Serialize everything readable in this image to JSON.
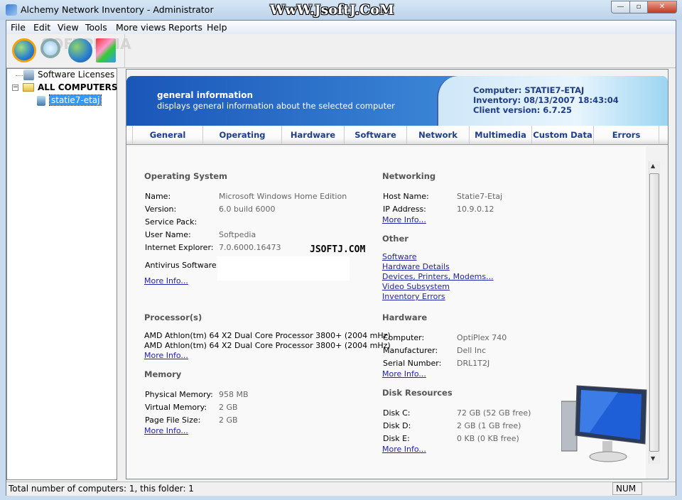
{
  "window": {
    "title": "Alchemy Network Inventory - Administrator",
    "watermark": "WwW.JsoftJ.CoM",
    "minimize": "—",
    "maximize": "▫",
    "close": "✕"
  },
  "menu": [
    "File",
    "Edit",
    "View",
    "Tools",
    "More views",
    "Reports",
    "Help"
  ],
  "toolbar": {
    "icons": [
      "refresh-globe-icon",
      "search-icon",
      "internet-explorer-icon",
      "reports-icon"
    ],
    "watermark": "SOFTPEDIA"
  },
  "tree": {
    "items": [
      {
        "label": "Software Licenses",
        "icon": "license-icon"
      },
      {
        "label": "ALL COMPUTERS",
        "icon": "folder-icon",
        "expander": "−"
      },
      {
        "label": "statie7-etaj",
        "icon": "computer-icon",
        "selected": true
      }
    ]
  },
  "header": {
    "title": "general information",
    "subtitle": "displays general information about the selected computer",
    "computer": "Computer: STATIE7-ETAJ",
    "inventory": "Inventory: 08/13/2007 18:43:04",
    "client_version": "Client version: 6.7.25"
  },
  "tabs": [
    "General",
    "Operating System",
    "Hardware",
    "Software",
    "Network",
    "Multimedia",
    "Custom Data",
    "Errors"
  ],
  "os": {
    "title": "Operating System",
    "rows": [
      [
        "Name:",
        "Microsoft Windows Home Edition"
      ],
      [
        "Version:",
        "6.0 build 6000"
      ],
      [
        "Service Pack:",
        ""
      ],
      [
        "User Name:",
        "Softpedia"
      ],
      [
        "Internet Explorer:",
        "7.0.6000.16473"
      ]
    ],
    "antivirus_label": "Antivirus Software:",
    "more": "More Info..."
  },
  "overlay": "JSOFTJ.COM",
  "processor": {
    "title": "Processor(s)",
    "lines": [
      "AMD Athlon(tm) 64 X2 Dual Core Processor 3800+ (2004 mHz)",
      "AMD Athlon(tm) 64 X2 Dual Core Processor 3800+ (2004 mHz)"
    ],
    "more": "More Info..."
  },
  "memory": {
    "title": "Memory",
    "rows": [
      [
        "Physical Memory:",
        "958 MB"
      ],
      [
        "Virtual Memory:",
        "2 GB"
      ],
      [
        "Page File Size:",
        "2 GB"
      ]
    ],
    "more": "More Info..."
  },
  "networking": {
    "title": "Networking",
    "rows": [
      [
        "Host Name:",
        "Statie7-Etaj"
      ],
      [
        "IP Address:",
        "10.9.0.12"
      ]
    ],
    "more": "More Info..."
  },
  "other": {
    "title": "Other",
    "links": [
      "Software",
      "Hardware Details",
      "Devices, Printers, Modems...",
      "Video Subsystem",
      "Inventory Errors"
    ]
  },
  "hardware": {
    "title": "Hardware",
    "rows": [
      [
        "Computer:",
        "OptiPlex 740"
      ],
      [
        "Manufacturer:",
        "Dell Inc"
      ],
      [
        "Serial Number:",
        "DRL1T2J"
      ]
    ],
    "more": "More Info..."
  },
  "disk": {
    "title": "Disk Resources",
    "rows": [
      [
        "Disk C:",
        "72 GB (52 GB free)"
      ],
      [
        "Disk D:",
        "2 GB (1 GB free)"
      ],
      [
        "Disk E:",
        "0 KB (0 KB free)"
      ]
    ],
    "more": "More Info..."
  },
  "status": {
    "text": "Total number of computers: 1, this folder: 1",
    "num": "NUM"
  }
}
